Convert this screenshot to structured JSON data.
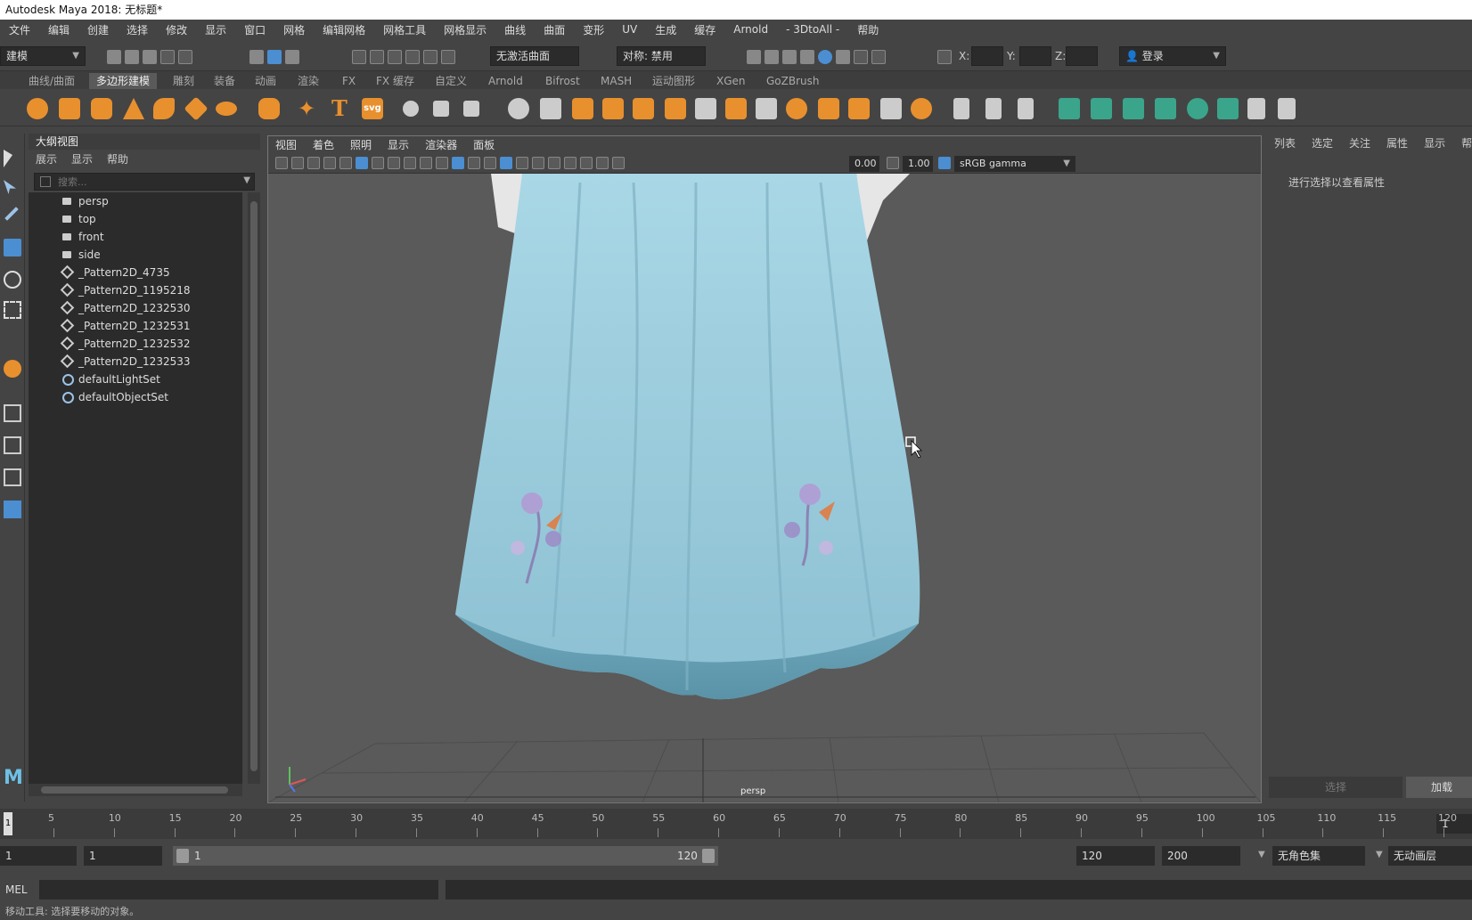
{
  "window": {
    "title": "Autodesk Maya 2018: 无标题*"
  },
  "menubar": [
    "文件",
    "编辑",
    "创建",
    "选择",
    "修改",
    "显示",
    "窗口",
    "网格",
    "编辑网格",
    "网格工具",
    "网格显示",
    "曲线",
    "曲面",
    "变形",
    "UV",
    "生成",
    "缓存",
    "Arnold",
    "- 3DtoAll -",
    "帮助"
  ],
  "status": {
    "mode": "建模",
    "live_surface": "无激活曲面",
    "symmetry": "对称: 禁用",
    "x_label": "X:",
    "y_label": "Y:",
    "z_label": "Z:",
    "login": "登录"
  },
  "shelf_tabs": [
    "曲线/曲面",
    "多边形建模",
    "雕刻",
    "装备",
    "动画",
    "渲染",
    "FX",
    "FX 缓存",
    "自定义",
    "Arnold",
    "Bifrost",
    "MASH",
    "运动图形",
    "XGen",
    "GoZBrush"
  ],
  "shelf_active": "多边形建模",
  "shelf_text_icon": "T",
  "shelf_svg_icon": "svg",
  "outliner": {
    "title": "大纲视图",
    "menu": [
      "展示",
      "显示",
      "帮助"
    ],
    "search_placeholder": "搜索...",
    "items": [
      {
        "label": "persp",
        "icon": "camera-icon"
      },
      {
        "label": "top",
        "icon": "camera-icon"
      },
      {
        "label": "front",
        "icon": "camera-icon"
      },
      {
        "label": "side",
        "icon": "camera-icon"
      },
      {
        "label": "_Pattern2D_4735",
        "icon": "mesh-icon"
      },
      {
        "label": "_Pattern2D_1195218",
        "icon": "mesh-icon"
      },
      {
        "label": "_Pattern2D_1232530",
        "icon": "mesh-icon"
      },
      {
        "label": "_Pattern2D_1232531",
        "icon": "mesh-icon"
      },
      {
        "label": "_Pattern2D_1232532",
        "icon": "mesh-icon"
      },
      {
        "label": "_Pattern2D_1232533",
        "icon": "mesh-icon"
      },
      {
        "label": "defaultLightSet",
        "icon": "set-icon"
      },
      {
        "label": "defaultObjectSet",
        "icon": "set-icon"
      }
    ]
  },
  "viewport": {
    "menu": [
      "视图",
      "着色",
      "照明",
      "显示",
      "渲染器",
      "面板"
    ],
    "exposure": "0.00",
    "gamma": "1.00",
    "colorspace": "sRGB gamma",
    "camera_label": "persp"
  },
  "attribute_editor": {
    "menu": [
      "列表",
      "选定",
      "关注",
      "属性",
      "显示",
      "帮助"
    ],
    "message": "进行选择以查看属性",
    "select_button": "选择",
    "load_button": "加载"
  },
  "timeline": {
    "ticks": [
      "5",
      "10",
      "15",
      "20",
      "25",
      "30",
      "35",
      "40",
      "45",
      "50",
      "55",
      "60",
      "65",
      "70",
      "75",
      "80",
      "85",
      "90",
      "95",
      "100",
      "105",
      "110",
      "115",
      "120"
    ],
    "current_frame": "1",
    "current_frame_right": "1"
  },
  "range": {
    "start": "1",
    "playback_start": "1",
    "slider_start": "1",
    "slider_end": "120",
    "playback_end": "120",
    "end": "200",
    "character_set": "无角色集",
    "anim_layer": "无动画层"
  },
  "command": {
    "lang": "MEL"
  },
  "help_line": "移动工具: 选择要移动的对象。",
  "colors": {
    "accent_orange": "#e8902e",
    "accent_blue": "#4b8ed1",
    "skirt_blue": "#8ec6d8"
  }
}
